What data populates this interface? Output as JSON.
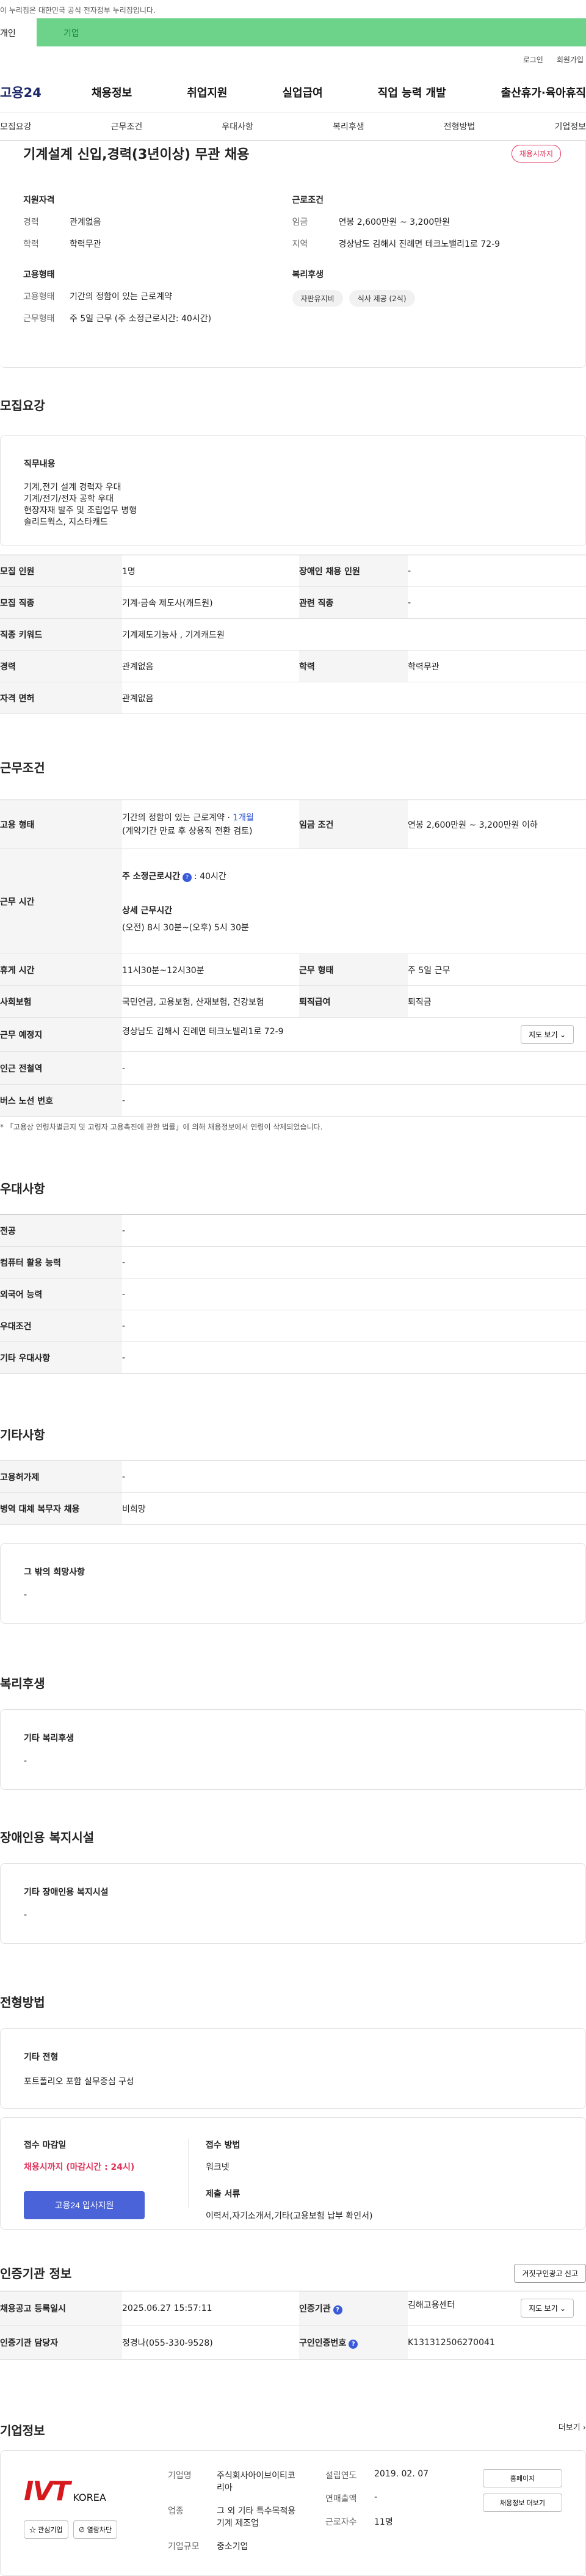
{
  "gov": {
    "notice": "이 누리집은 대한민국 공식 전자정부 누리집입니다."
  },
  "top_tabs": {
    "person": "개인",
    "company": "기업"
  },
  "util": {
    "login": "로그인",
    "join": "회원가입"
  },
  "gnb": {
    "logo": "고용24",
    "items": [
      "채용정보",
      "취업지원",
      "실업급여",
      "직업 능력 개발",
      "출산휴가·육아휴직"
    ]
  },
  "lnb": {
    "items": [
      "모집요강",
      "근무조건",
      "우대사항",
      "복리후생",
      "전형방법",
      "기업정보"
    ]
  },
  "job": {
    "title": "기계설계 신입,경력(3년이상) 무관 채용",
    "deadline_badge": "채용시까지"
  },
  "summary": {
    "qual_head": "지원자격",
    "career_k": "경력",
    "career_v": "관계없음",
    "edu_k": "학력",
    "edu_v": "학력무관",
    "work_head": "근로조건",
    "wage_k": "임금",
    "wage_v": "연봉 2,600만원 ~ 3,200만원",
    "region_k": "지역",
    "region_v": "경상남도 김해시 진례면 테크노밸리1로 72-9",
    "emp_head": "고용형태",
    "emptype_k": "고용형태",
    "emptype_v": "기간의 정함이 있는 근로계약",
    "worktype_k": "근무형태",
    "worktype_v": "주 5일 근무 (주 소정근로시간: 40시간)",
    "welfare_head": "복리후생",
    "welfare_tags": [
      "자판유지비",
      "식사 제공 (2식)"
    ]
  },
  "recruit": {
    "title": "모집요강",
    "duty_head": "직무내용",
    "duty_text": "기계,전기 설계 경력자 우대\n기계/전기/전자 공학 우대\n현장자재 발주 및 조립업무 병행\n솔리드웍스, 지스타캐드",
    "rows": [
      {
        "k1": "모집 인원",
        "v1": "1명",
        "k2": "장애인 채용 인원",
        "v2": "-"
      },
      {
        "k1": "모집 직종",
        "v1": "기계·금속 제도사(캐드원)",
        "k2": "관련 직종",
        "v2": "-"
      },
      {
        "k1": "직종 키워드",
        "v1": "기계제도기능사 , 기계캐드원",
        "k2": "",
        "v2": ""
      },
      {
        "k1": "경력",
        "v1": "관계없음",
        "k2": "학력",
        "v2": "학력무관"
      },
      {
        "k1": "자격 면허",
        "v1": "관계없음",
        "k2": "",
        "v2": ""
      }
    ]
  },
  "conditions": {
    "title": "근무조건",
    "emp_k": "고용 형태",
    "emp_v1": "기간의 정함이 있는 근로계약 · ",
    "emp_period": "1개월",
    "emp_v2": "(계약기간 만료 후 상용직 전환 검토)",
    "wage_k": "임금 조건",
    "wage_v": "연봉 2,600만원 ~ 3,200만원 이하",
    "time_k": "근무 시간",
    "time_head": "주 소정근로시간",
    "time_val": ": 40시간",
    "detail_head": "상세 근무시간",
    "detail_val": "(오전) 8시 30분~(오후) 5시 30분",
    "break_k": "휴게 시간",
    "break_v": "11시30분~12시30분",
    "wtype_k": "근무 형태",
    "wtype_v": "주 5일 근무",
    "ins_k": "사회보험",
    "ins_v": "국민연금, 고용보험, 산재보험, 건강보험",
    "ret_k": "퇴직급여",
    "ret_v": "퇴직금",
    "loc_k": "근무 예정지",
    "loc_v": "경상남도 김해시 진례면 테크노밸리1로 72-9",
    "map_btn": "지도 보기 ⌄",
    "subway_k": "인근 전철역",
    "subway_v": "-",
    "bus_k": "버스 노선 번호",
    "bus_v": "-",
    "note": "* 「고용상 연령차별금지 및 고령자 고용촉진에 관한 법률」에 의해 채용정보에서 연령이 삭제되었습니다."
  },
  "preference": {
    "title": "우대사항",
    "rows": [
      {
        "k": "전공",
        "v": "-"
      },
      {
        "k": "컴퓨터 활용 능력",
        "v": "-"
      },
      {
        "k": "외국어 능력",
        "v": "-"
      },
      {
        "k": "우대조건",
        "v": "-"
      },
      {
        "k": "기타 우대사항",
        "v": "-"
      }
    ]
  },
  "etc": {
    "title": "기타사항",
    "rows": [
      {
        "k": "고용허가제",
        "v": "-"
      },
      {
        "k": "병역 대체 복무자 채용",
        "v": "비희망"
      }
    ],
    "hope_head": "그 밖의 희망사항",
    "hope_v": "-"
  },
  "welfare": {
    "title": "복리후생",
    "head": "기타 복리후생",
    "v": "-"
  },
  "disabled": {
    "title": "장애인용 복지시설",
    "head": "기타 장애인용 복지시설",
    "v": "-"
  },
  "selection": {
    "title": "전형방법",
    "head": "기타 전형",
    "v": "포트폴리오 포함 실무중심 구성",
    "close_head": "접수 마감일",
    "close_v": "채용시까지 (마감시간 : 24시)",
    "apply_btn": "고용24 입사지원",
    "method_head": "접수 방법",
    "method_v": "워크넷",
    "docs_head": "제출 서류",
    "docs_v": "이력서,자기소개서,기타(고용보험 납부 확인서)"
  },
  "agency": {
    "title": "인증기관 정보",
    "report_btn": "거짓구인광고 신고",
    "reg_k": "채용공고 등록일시",
    "reg_v": "2025.06.27 15:57:11",
    "org_k": "인증기관",
    "org_v": "김해고용센터",
    "map_btn": "지도 보기 ⌄",
    "mgr_k": "인증기관 담당자",
    "mgr_v": "정경나(055-330-9528)",
    "no_k": "구인인증번호",
    "no_v": "K131312506270041"
  },
  "corp": {
    "title": "기업정보",
    "more": "더보기 ›",
    "logo_main": "IVT",
    "logo_sub": "KOREA",
    "fav_btn": "☆ 관심기업",
    "block_btn": "⊘ 열람차단",
    "name_k": "기업명",
    "name_v": "주식회사아이브이티코리아",
    "ind_k": "업종",
    "ind_v": "그 외 기타 특수목적용 기계 제조업",
    "size_k": "기업규모",
    "size_v": "중소기업",
    "est_k": "설립연도",
    "est_v": "2019. 02. 07",
    "sales_k": "연매출액",
    "sales_v": "-",
    "emp_k": "근로자수",
    "emp_v": "11명",
    "home_btn": "홈페이지",
    "other_btn": "채용정보 더보기"
  }
}
